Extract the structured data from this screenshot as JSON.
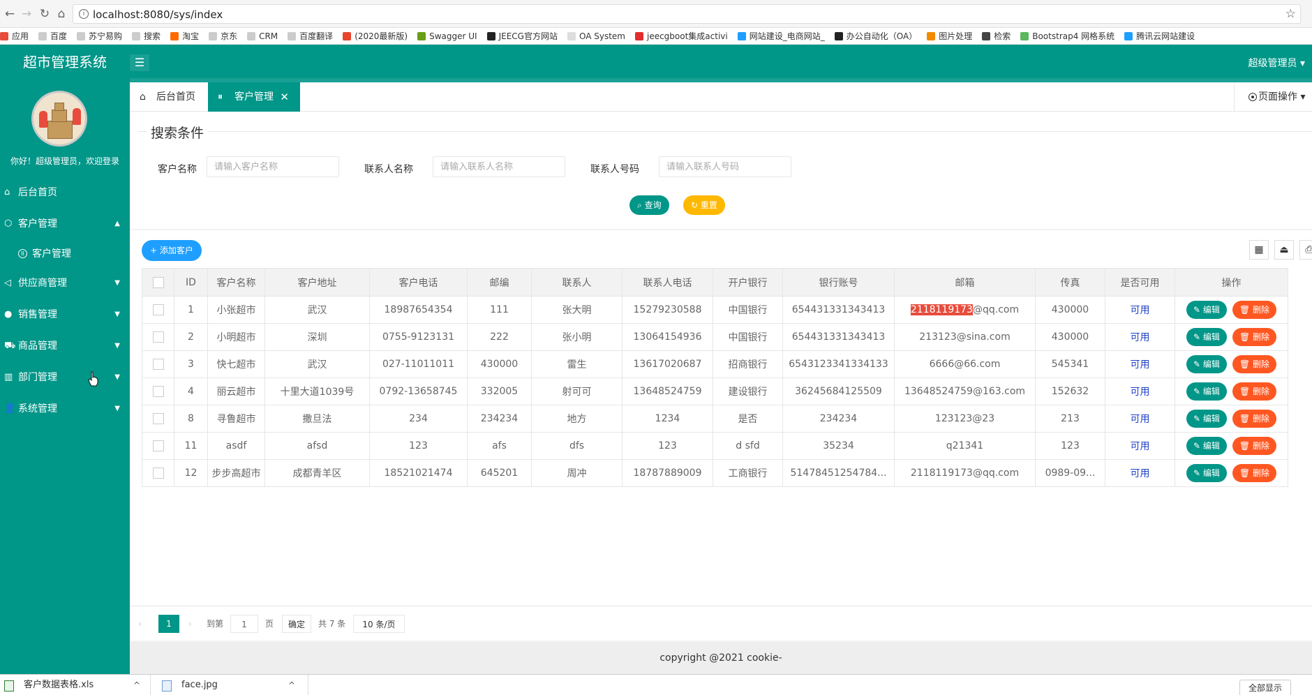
{
  "browser": {
    "url": "localhost:8080/sys/index",
    "bookmarks": [
      {
        "label": "应用",
        "color": "#e74c3c"
      },
      {
        "label": "百度",
        "color": "#cccccc"
      },
      {
        "label": "苏宁易购",
        "color": "#cccccc"
      },
      {
        "label": "搜索",
        "color": "#cccccc"
      },
      {
        "label": "淘宝",
        "color": "#ff6a00"
      },
      {
        "label": "京东",
        "color": "#cccccc"
      },
      {
        "label": "CRM",
        "color": "#cccccc"
      },
      {
        "label": "百度翻译",
        "color": "#cccccc"
      },
      {
        "label": "(2020最新版)",
        "color": "#e8452c"
      },
      {
        "label": "Swagger UI",
        "color": "#6a9e18"
      },
      {
        "label": "JEECG官方网站",
        "color": "#222222"
      },
      {
        "label": "OA System",
        "color": "#dddddd"
      },
      {
        "label": "jeecgboot集成activi",
        "color": "#e12d2d"
      },
      {
        "label": "网站建设_电商网站_",
        "color": "#1e9fff"
      },
      {
        "label": "办公自动化（OA）",
        "color": "#222222"
      },
      {
        "label": "图片处理",
        "color": "#f38b00"
      },
      {
        "label": "检索",
        "color": "#444444"
      },
      {
        "label": "Bootstrap4 网格系统",
        "color": "#5cb85c"
      },
      {
        "label": "腾讯云网站建设",
        "color": "#1e9fff"
      }
    ]
  },
  "header": {
    "app_title": "超市管理系统",
    "menu_toggle_icon": "☰",
    "user_label": "超级管理员 ▾"
  },
  "sidebar": {
    "welcome": "你好！超级管理员，欢迎登录",
    "items": [
      {
        "label": "后台首页",
        "icon": "⌂"
      },
      {
        "label": "客户管理",
        "icon": "⬡",
        "arrow": "▲"
      },
      {
        "label": "客户管理",
        "icon": "II"
      },
      {
        "label": "供应商管理",
        "icon": "◁",
        "arrow": "▼"
      },
      {
        "label": "销售管理",
        "icon": "●",
        "arrow": "▼"
      },
      {
        "label": "商品管理",
        "icon": "⛟",
        "arrow": "▼"
      },
      {
        "label": "部门管理",
        "icon": "▥",
        "arrow": "▼"
      },
      {
        "label": "系统管理",
        "icon": "👤",
        "arrow": "▼"
      }
    ]
  },
  "tabs": {
    "home": "后台首页",
    "customer": "客户管理",
    "close_icon": "✕",
    "page_ops": "页面操作 ▾"
  },
  "search": {
    "legend": "搜索条件",
    "fields": [
      {
        "label": "客户名称",
        "placeholder": "请输入客户名称"
      },
      {
        "label": "联系人名称",
        "placeholder": "请输入联系人名称"
      },
      {
        "label": "联系人号码",
        "placeholder": "请输入联系人号码"
      }
    ],
    "query_label": "查询",
    "reset_label": "重置"
  },
  "grid": {
    "add_label": "+ 添加客户",
    "tool_icons": [
      "▦",
      "⏏",
      "⎙"
    ],
    "columns": [
      "ID",
      "客户名称",
      "客户地址",
      "客户电话",
      "邮编",
      "联系人",
      "联系人电话",
      "开户银行",
      "银行账号",
      "邮箱",
      "传真",
      "是否可用",
      "操作"
    ],
    "rows": [
      {
        "id": "1",
        "name": "小张超市",
        "address": "武汉",
        "phone": "18987654354",
        "zip": "111",
        "contact": "张大明",
        "contact_phone": "15279230588",
        "bank": "中国银行",
        "account": "654431331343413",
        "email_hl": "2118119173",
        "email": "@qq.com",
        "fax": "430000",
        "available": "可用"
      },
      {
        "id": "2",
        "name": "小明超市",
        "address": "深圳",
        "phone": "0755-9123131",
        "zip": "222",
        "contact": "张小明",
        "contact_phone": "13064154936",
        "bank": "中国银行",
        "account": "654431331343413",
        "email_hl": "",
        "email": "213123@sina.com",
        "fax": "430000",
        "available": "可用"
      },
      {
        "id": "3",
        "name": "快七超市",
        "address": "武汉",
        "phone": "027-11011011",
        "zip": "430000",
        "contact": "雷生",
        "contact_phone": "13617020687",
        "bank": "招商银行",
        "account": "6543123341334133",
        "email_hl": "",
        "email": "6666@66.com",
        "fax": "545341",
        "available": "可用"
      },
      {
        "id": "4",
        "name": "丽云超市",
        "address": "十里大道1039号",
        "phone": "0792-13658745",
        "zip": "332005",
        "contact": "射可可",
        "contact_phone": "13648524759",
        "bank": "建设银行",
        "account": "36245684125509",
        "email_hl": "",
        "email": "13648524759@163.com",
        "fax": "152632",
        "available": "可用"
      },
      {
        "id": "8",
        "name": "寻鲁超市",
        "address": "撒旦法",
        "phone": "234",
        "zip": "234234",
        "contact": "地方",
        "contact_phone": "1234",
        "bank": "是否",
        "account": "234234",
        "email_hl": "",
        "email": "123123@23",
        "fax": "213",
        "available": "可用"
      },
      {
        "id": "11",
        "name": "asdf",
        "address": "afsd",
        "phone": "123",
        "zip": "afs",
        "contact": "dfs",
        "contact_phone": "123",
        "bank": "d sfd",
        "account": "35234",
        "email_hl": "",
        "email": "q21341",
        "fax": "123",
        "available": "可用"
      },
      {
        "id": "12",
        "name": "步步高超市",
        "address": "成都青羊区",
        "phone": "18521021474",
        "zip": "645201",
        "contact": "周冲",
        "contact_phone": "18787889009",
        "bank": "工商银行",
        "account": "51478451254784...",
        "email_hl": "",
        "email": "2118119173@qq.com",
        "fax": "0989-09...",
        "available": "可用"
      }
    ],
    "edit_label": "✎ 编辑",
    "delete_label": "🗑 删除"
  },
  "pager": {
    "prev": "‹",
    "current": "1",
    "next": "›",
    "goto_label": "到第",
    "goto_value": "1",
    "page_unit": "页",
    "confirm": "确定",
    "total": "共 7 条",
    "size": "10 条/页"
  },
  "footer": {
    "copyright": "copyright @2021 cookie-"
  },
  "downloads": {
    "items": [
      {
        "name": "客户数据表格.xls",
        "caret": "^"
      },
      {
        "name": "face.jpg",
        "caret": "^"
      }
    ],
    "show_all": "全部显示"
  },
  "colors": {
    "primary": "#009688",
    "accent_blue": "#1e9fff",
    "warn": "#ffb800",
    "danger": "#ff5722"
  }
}
